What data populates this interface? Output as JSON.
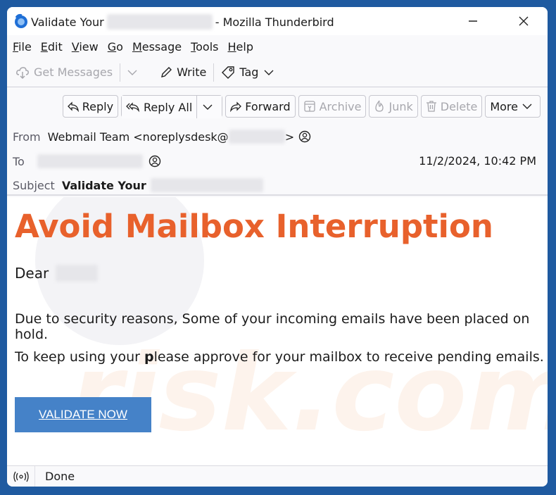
{
  "window": {
    "title_prefix": "Validate Your",
    "title_suffix": "- Mozilla Thunderbird"
  },
  "menu": [
    {
      "label": "File",
      "accel": "F",
      "rest": "ile"
    },
    {
      "label": "Edit",
      "accel": "E",
      "rest": "dit"
    },
    {
      "label": "View",
      "accel": "V",
      "rest": "iew"
    },
    {
      "label": "Go",
      "accel": "G",
      "rest": "o"
    },
    {
      "label": "Message",
      "accel": "M",
      "rest": "essage"
    },
    {
      "label": "Tools",
      "accel": "T",
      "rest": "ools"
    },
    {
      "label": "Help",
      "accel": "H",
      "rest": "elp"
    }
  ],
  "toolbar": {
    "get_messages": "Get Messages",
    "write": "Write",
    "tag": "Tag"
  },
  "actions": {
    "reply": "Reply",
    "reply_all": "Reply All",
    "forward": "Forward",
    "archive": "Archive",
    "junk": "Junk",
    "delete": "Delete",
    "more": "More"
  },
  "header": {
    "from_label": "From",
    "from_value": "Webmail Team <noreplysdesk@",
    "from_close": ">",
    "to_label": "To",
    "date": "11/2/2024, 10:42 PM",
    "subject_label": "Subject",
    "subject_value": "Validate Your"
  },
  "message": {
    "headline": "Avoid Mailbox Interruption",
    "greeting": "Dear",
    "para1": "Due to security reasons, Some of your incoming emails have been placed on hold.",
    "para2_a": "To keep using your ",
    "para2_b": "p",
    "para2_c": "lease approve for your mailbox to receive pending emails.",
    "cta_label": "VALIDATE NOW ",
    "headline_color": "#e8612c",
    "cta_color": "#4582c8"
  },
  "status": {
    "text": "Done"
  }
}
